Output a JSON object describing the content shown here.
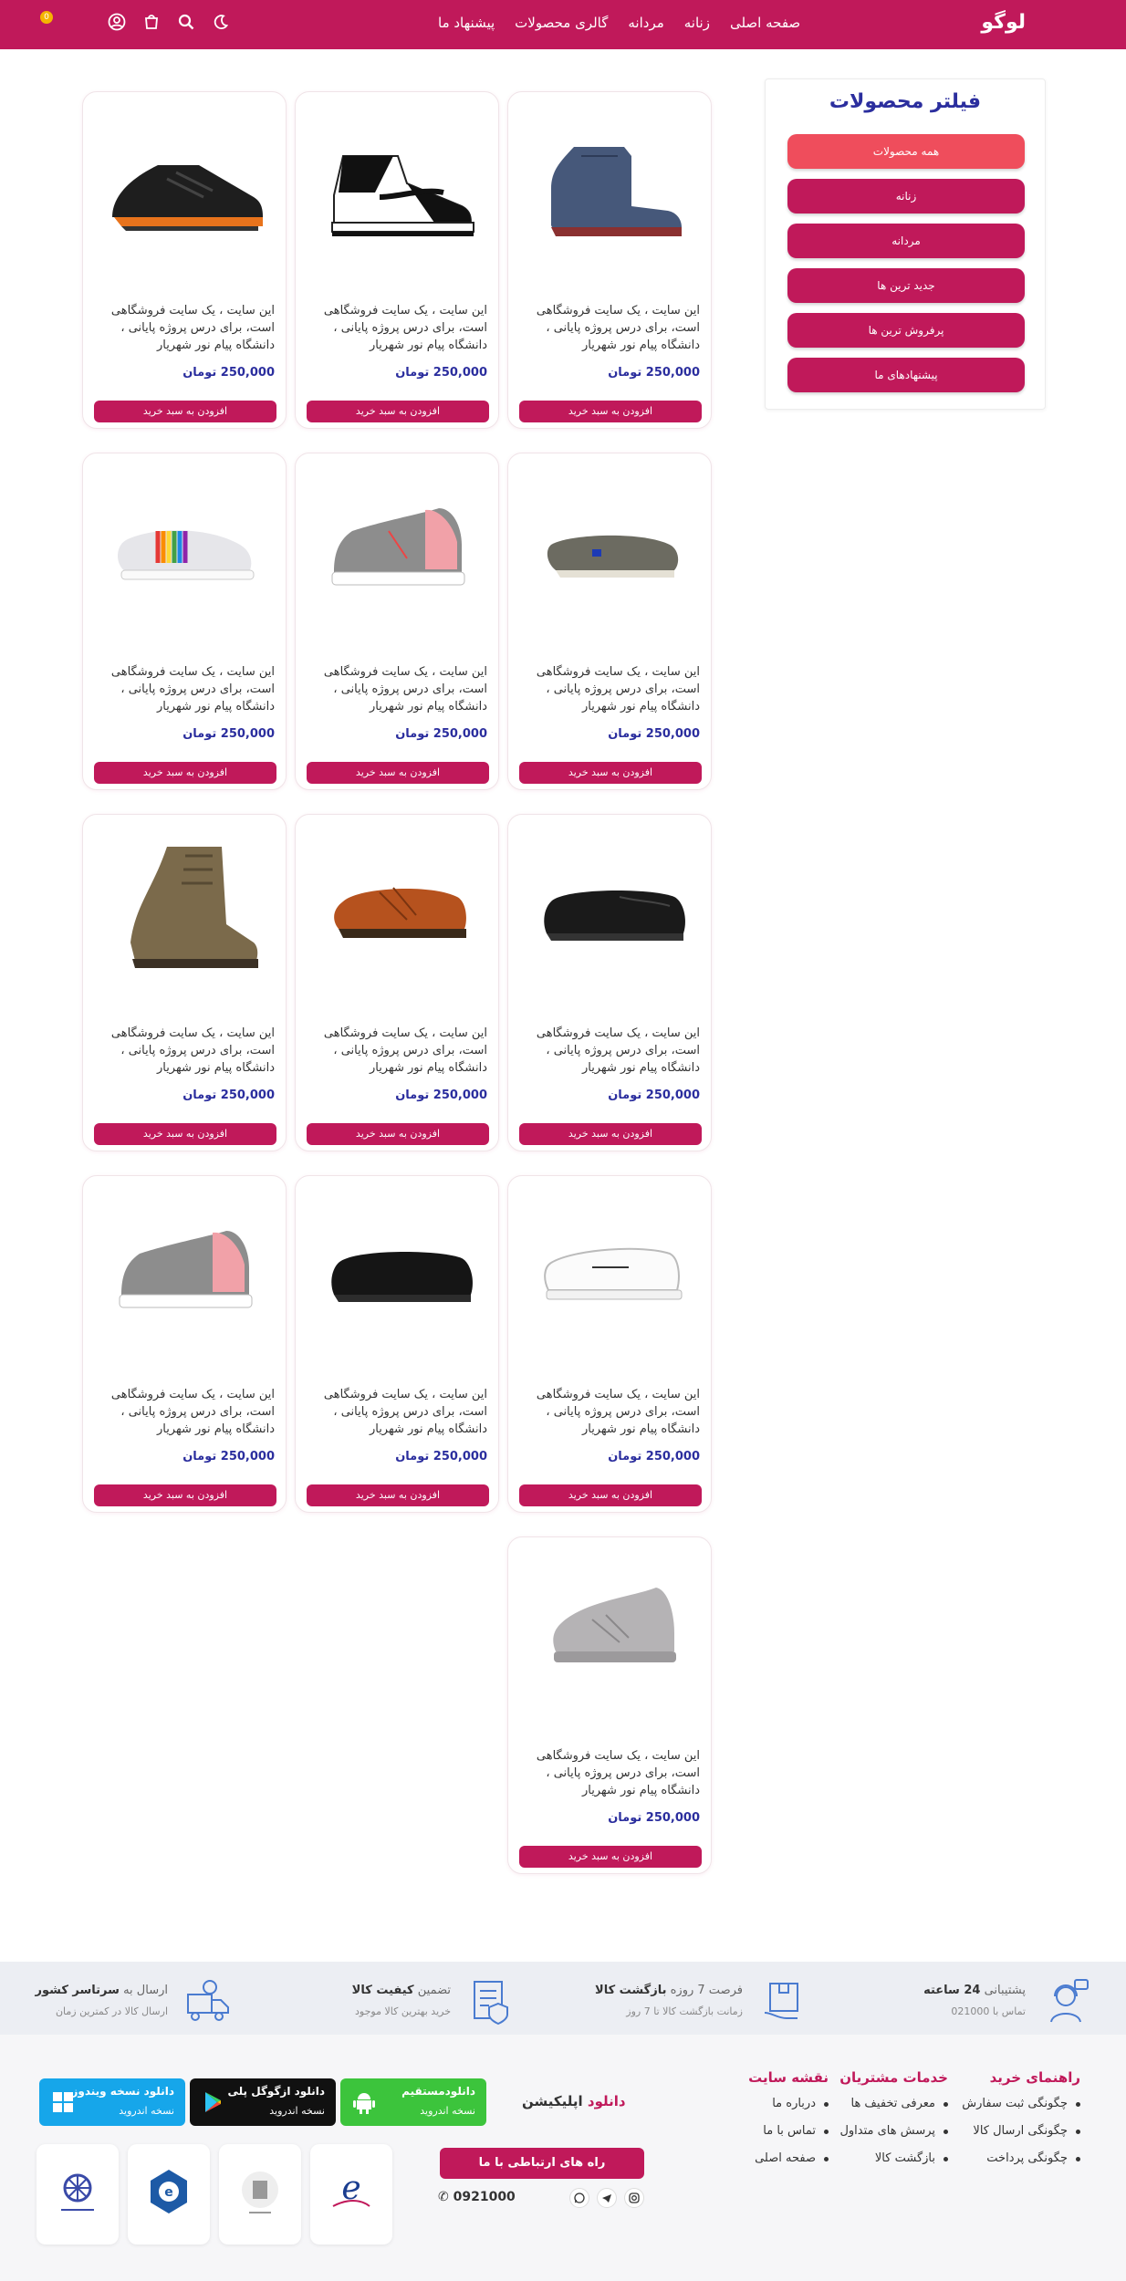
{
  "header": {
    "logo": "لوگو",
    "nav": [
      "صفحه اصلی",
      "زنانه",
      "مردانه",
      "گالری محصولات",
      "پیشنهاد ما"
    ],
    "cart_count": "0",
    "icons": [
      "moon-icon",
      "search-icon",
      "cart-icon",
      "user-icon"
    ],
    "brand_color": "#c0195a"
  },
  "filter": {
    "title": "فیلتر محصولات",
    "buttons": [
      "همه محصولات",
      "زنانه",
      "مردانه",
      "جدید ترین ها",
      "پرفروش ترین ها",
      "پیشنهادهای ما"
    ],
    "active_color": "#ef4d5c"
  },
  "products": [
    {
      "image": "navy-ankle-boot",
      "description": "این سایت ، یک سایت فروشگاهی است، برای درس پروژه پایانی ، دانشگاه پیام نور شهریار",
      "price": "250,000 تومان",
      "button": "افزودن به سبد خرید"
    },
    {
      "image": "black-white-high-top-sneaker",
      "description": "این سایت ، یک سایت فروشگاهی است، برای درس پروژه پایانی ، دانشگاه پیام نور شهریار",
      "price": "250,000 تومان",
      "button": "افزودن به سبد خرید"
    },
    {
      "image": "black-orange-running-shoe",
      "description": "این سایت ، یک سایت فروشگاهی است، برای درس پروژه پایانی ، دانشگاه پیام نور شهریار",
      "price": "250,000 تومان",
      "button": "افزودن به سبد خرید"
    },
    {
      "image": "grey-canvas-slip-on",
      "description": "این سایت ، یک سایت فروشگاهی است، برای درس پروژه پایانی ، دانشگاه پیام نور شهریار",
      "price": "250,000 تومان",
      "button": "افزودن به سبد خرید"
    },
    {
      "image": "grey-pink-sneaker",
      "description": "این سایت ، یک سایت فروشگاهی است، برای درس پروژه پایانی ، دانشگاه پیام نور شهریار",
      "price": "250,000 تومان",
      "button": "افزودن به سبد خرید"
    },
    {
      "image": "white-rainbow-slip-on",
      "description": "این سایت ، یک سایت فروشگاهی است، برای درس پروژه پایانی ، دانشگاه پیام نور شهریار",
      "price": "250,000 تومان",
      "button": "افزودن به سبد خرید"
    },
    {
      "image": "black-leather-loafer",
      "description": "این سایت ، یک سایت فروشگاهی است، برای درس پروژه پایانی ، دانشگاه پیام نور شهریار",
      "price": "250,000 تومان",
      "button": "افزودن به سبد خرید"
    },
    {
      "image": "brown-leather-oxford",
      "description": "این سایت ، یک سایت فروشگاهی است، برای درس پروژه پایانی ، دانشگاه پیام نور شهریار",
      "price": "250,000 تومان",
      "button": "افزودن به سبد خرید"
    },
    {
      "image": "olive-high-boot",
      "description": "این سایت ، یک سایت فروشگاهی است، برای درس پروژه پایانی ، دانشگاه پیام نور شهریار",
      "price": "250,000 تومان",
      "button": "افزودن به سبد خرید"
    },
    {
      "image": "white-classic-sneaker",
      "description": "این سایت ، یک سایت فروشگاهی است، برای درس پروژه پایانی ، دانشگاه پیام نور شهریار",
      "price": "250,000 تومان",
      "button": "افزودن به سبد خرید"
    },
    {
      "image": "black-leather-loafer",
      "description": "این سایت ، یک سایت فروشگاهی است، برای درس پروژه پایانی ، دانشگاه پیام نور شهریار",
      "price": "250,000 تومان",
      "button": "افزودن به سبد خرید"
    },
    {
      "image": "grey-pink-sneaker",
      "description": "این سایت ، یک سایت فروشگاهی است، برای درس پروژه پایانی ، دانشگاه پیام نور شهریار",
      "price": "250,000 تومان",
      "button": "افزودن به سبد خرید"
    },
    {
      "image": "grey-knit-sneaker",
      "description": "این سایت ، یک سایت فروشگاهی است، برای درس پروژه پایانی ، دانشگاه پیام نور شهریار",
      "price": "250,000 تومان",
      "button": "افزودن به سبد خرید"
    }
  ],
  "features": [
    {
      "icon": "support-agent-icon",
      "title_prefix": "پشتیبانی",
      "title_bold": "24 ساعته",
      "subtitle": "تماس با 021000"
    },
    {
      "icon": "return-box-icon",
      "title_prefix": "فرصت 7 روزه",
      "title_bold": "بازگشت کالا",
      "subtitle": "زمانت بازگشت کالا تا 7 روز"
    },
    {
      "icon": "quality-document-icon",
      "title_prefix": "تضمین",
      "title_bold": "کیفیت کالا",
      "subtitle": "خرید بهترین کالا موجود"
    },
    {
      "icon": "fast-delivery-icon",
      "title_prefix": "ارسال به",
      "title_bold": "سرتاسر کشور",
      "subtitle": "ارسال کالا در کمترین زمان"
    }
  ],
  "footer": {
    "columns": [
      {
        "title": "راهنمای خرید",
        "items": [
          "چگونگی ثبت سفارش",
          "چگونگی ارسال کالا",
          "چگونگی پرداخت"
        ]
      },
      {
        "title": "خدمات مشتریان",
        "items": [
          "معرفی تخفیف ها",
          "پرسش های متداول",
          "بازگشت کالا"
        ]
      },
      {
        "title": "نقشه سایت",
        "items": [
          "درباره ما",
          "تماس با ما",
          "صفحه اصلی"
        ]
      }
    ],
    "app": {
      "label_prefix": "دانلود",
      "label_highlight": "اپلیکیشن"
    },
    "stores": [
      {
        "title": "دانلودمستقیم",
        "subtitle": "نسخه اندروید",
        "color": "#3cc43c",
        "icon": "android-icon"
      },
      {
        "title": "دانلود ازگوگل پلی",
        "subtitle": "نسخه اندروید",
        "color": "#111111",
        "icon": "google-play-icon"
      },
      {
        "title": "دانلود نسخه ویندوز",
        "subtitle": "نسخه اندروید",
        "color": "#16a6ea",
        "icon": "windows-icon"
      }
    ],
    "contact_button": "راه های ارتباطی با ما",
    "phone": "0921000",
    "socials": [
      "instagram-icon",
      "telegram-icon",
      "whatsapp-icon"
    ],
    "badges": [
      "enamad-badge",
      "samandehi-badge",
      "e-trust-badge",
      "union-badge"
    ]
  }
}
